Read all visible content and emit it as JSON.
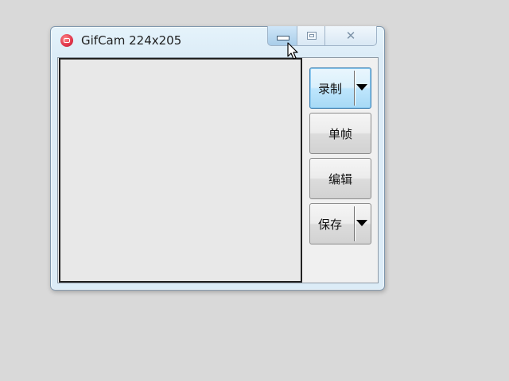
{
  "window": {
    "title": "GifCam 224x205",
    "caption_buttons": {
      "minimize": "minimize",
      "maximize": "maximize",
      "close": "close"
    }
  },
  "toolbar": {
    "record_label": "录制",
    "single_frame_label": "单帧",
    "edit_label": "编辑",
    "save_label": "保存"
  },
  "icons": {
    "app": "gifcam-app-icon",
    "minimize": "minimize-icon",
    "maximize": "maximize-icon",
    "close": "close-icon",
    "record_dropdown": "dropdown-arrow-icon",
    "save_dropdown": "dropdown-arrow-icon",
    "cursor": "mouse-cursor-icon"
  },
  "colors": {
    "desktop": "#d9d9d9",
    "window_frame": "#dcecf7",
    "active_button_border": "#3c7fb1",
    "app_icon": "#e0344a"
  }
}
